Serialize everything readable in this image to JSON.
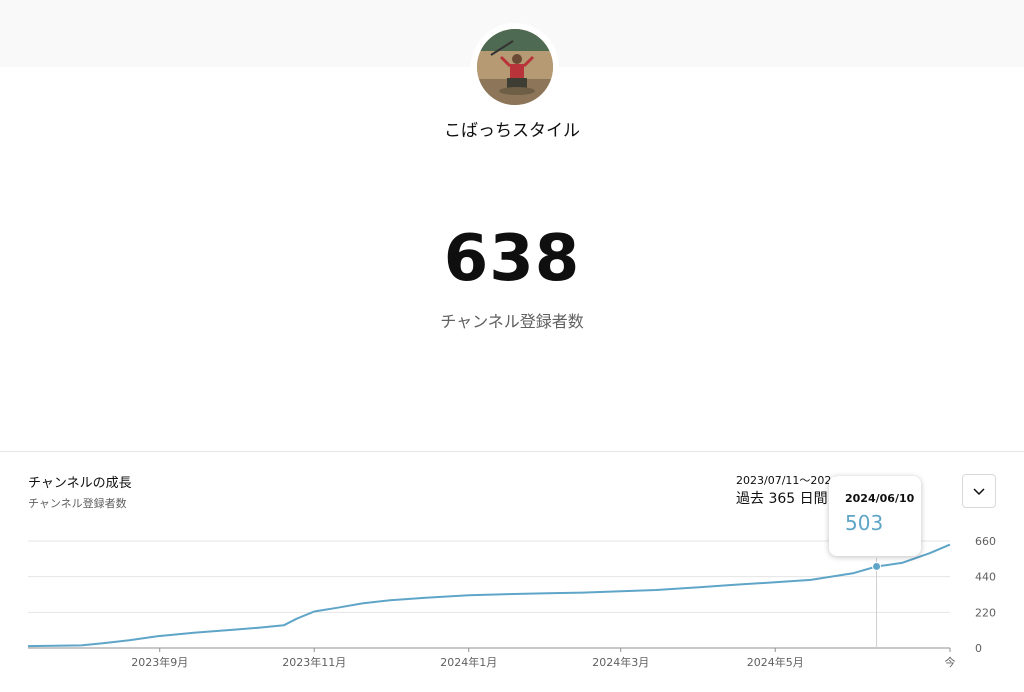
{
  "channel": {
    "name": "こばっちスタイル",
    "subscriber_count": "638",
    "subscriber_label": "チャンネル登録者数"
  },
  "card": {
    "title": "チャンネルの成長",
    "subtitle": "チャンネル登録者数",
    "date_range": "2023/07/11～2024/07/09",
    "period_label": "過去 365 日間",
    "dropdown_icon": "chevron-down-icon"
  },
  "tooltip": {
    "date": "2024/06/10",
    "value": "503"
  },
  "colors": {
    "line": "#5fa5c8",
    "accent_value": "#5fa5c8"
  },
  "chart_data": {
    "type": "line",
    "series": [
      {
        "x": [
          "2023-07-11",
          "2023-08-01",
          "2023-08-10",
          "2023-08-20",
          "2023-08-31",
          "2023-09-15",
          "2023-09-30",
          "2023-10-10",
          "2023-10-20",
          "2023-10-25",
          "2023-11-01",
          "2023-11-10",
          "2023-11-20",
          "2023-12-01",
          "2023-12-15",
          "2024-01-01",
          "2024-01-15",
          "2024-02-01",
          "2024-02-15",
          "2024-03-01",
          "2024-03-15",
          "2024-04-01",
          "2024-04-15",
          "2024-05-01",
          "2024-05-15",
          "2024-06-01",
          "2024-06-10",
          "2024-06-20",
          "2024-07-01",
          "2024-07-09"
        ],
        "y": [
          12,
          16,
          30,
          48,
          72,
          95,
          112,
          125,
          140,
          180,
          225,
          248,
          275,
          295,
          310,
          325,
          332,
          338,
          342,
          350,
          358,
          375,
          390,
          405,
          420,
          462,
          503,
          525,
          585,
          638
        ]
      }
    ],
    "x_ticks": [
      {
        "date": "2023-09-01",
        "label": "2023年9月"
      },
      {
        "date": "2023-11-01",
        "label": "2023年11月"
      },
      {
        "date": "2024-01-01",
        "label": "2024年1月"
      },
      {
        "date": "2024-03-01",
        "label": "2024年3月"
      },
      {
        "date": "2024-05-01",
        "label": "2024年5月"
      },
      {
        "date": "2024-07-09",
        "label": "今"
      }
    ],
    "y_ticks": [
      0,
      220,
      440,
      660
    ],
    "ylim": [
      0,
      660
    ],
    "xlim": [
      "2023-07-11",
      "2024-07-09"
    ],
    "highlight": {
      "x": "2024-06-10",
      "y": 503
    },
    "grid": true
  }
}
